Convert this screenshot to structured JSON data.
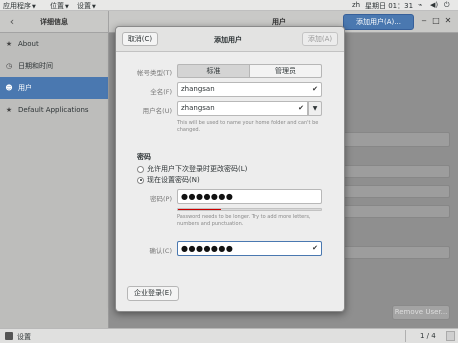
{
  "topbar": {
    "apps_label": "应用程序",
    "places_label": "位置",
    "settings_label": "设置",
    "lang": "zh",
    "clock": "星期日 01：31"
  },
  "header": {
    "sidebar_title": "详细信息",
    "center_title": "用户",
    "add_user_label": "添加用户(A)..."
  },
  "sidebar": {
    "items": [
      {
        "label": "About",
        "icon": "star-icon"
      },
      {
        "label": "日期和时间",
        "icon": "clock-icon"
      },
      {
        "label": "用户",
        "icon": "users-icon"
      },
      {
        "label": "Default Applications",
        "icon": "star-icon"
      }
    ]
  },
  "main": {
    "remove_user_label": "Remove User..."
  },
  "bottombar": {
    "label": "设置",
    "page": "1 / 4"
  },
  "dialog": {
    "cancel_label": "取消(C)",
    "title": "添加用户",
    "add_label": "添加(A)",
    "account_type_label": "帐号类型(T)",
    "account_types": [
      "标准",
      "管理员"
    ],
    "fullname_label": "全名(F)",
    "fullname_value": "zhangsan",
    "username_label": "用户名(U)",
    "username_value": "zhangsan",
    "username_hint": "This will be used to name your home folder and can't be changed.",
    "password_section": "密码",
    "radio_later": "允许用户下次登录时更改密码(L)",
    "radio_now": "现在设置密码(N)",
    "password_label": "密码(P)",
    "password_value": "●●●●●●●",
    "password_strength": 0.3,
    "password_hint": "Password needs to be longer. Try to add more letters, numbers and punctuation.",
    "confirm_label": "确认(C)",
    "confirm_value": "●●●●●●●",
    "enterprise_label": "企业登录(E)"
  },
  "colors": {
    "accent": "#4a78b0",
    "strength_weak": "#cc0000"
  }
}
